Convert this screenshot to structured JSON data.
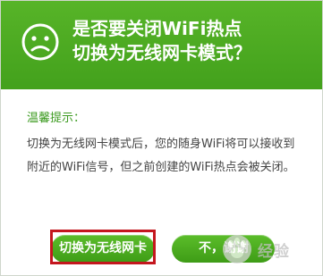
{
  "dialog": {
    "title_line1": "是否要关闭WiFi热点",
    "title_line2": "切换为无线网卡模式？",
    "header_icon": "sad-face-icon",
    "accent_color": "#4caa22",
    "highlight_color": "#c4171e"
  },
  "tip": {
    "heading": "温馨提示：",
    "line1": "切换为无线网卡模式后，您的随身WiFi将可以接收到",
    "line2": "附近的WiFi信号，但之前创建的WiFi热点会被关闭。"
  },
  "buttons": {
    "switch_label": "切换为无线网卡",
    "no_label": "不，谢谢"
  },
  "watermark": {
    "text": "经验",
    "icon": "baidu-paw-icon"
  }
}
